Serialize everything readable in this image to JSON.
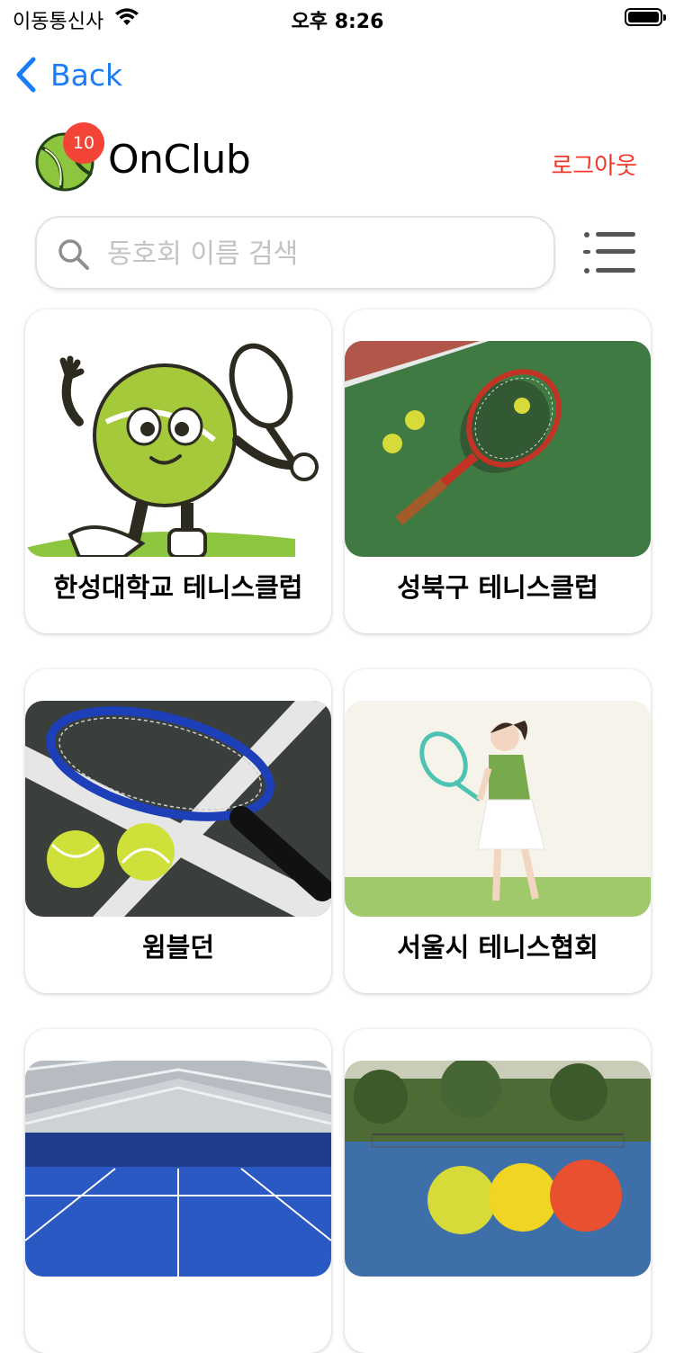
{
  "status_bar": {
    "carrier": "이동통신사",
    "time": "오후 8:26"
  },
  "nav": {
    "back_label": "Back"
  },
  "header": {
    "title": "OnClub",
    "badge_count": "10",
    "logout_label": "로그아웃"
  },
  "search": {
    "placeholder": "동호회 이름 검색",
    "value": ""
  },
  "colors": {
    "accent": "#1a7cf6",
    "logout": "#f0372a",
    "badge": "#f34437"
  },
  "clubs": [
    {
      "name": "한성대학교 테니스클럽",
      "image": "tennis-ball-mascot"
    },
    {
      "name": "성북구 테니스클럽",
      "image": "racket-on-court"
    },
    {
      "name": "윔블던",
      "image": "racket-and-balls"
    },
    {
      "name": "서울시 테니스협회",
      "image": "girl-player-illustration"
    },
    {
      "name": "",
      "image": "indoor-courts"
    },
    {
      "name": "",
      "image": "outdoor-court-balls"
    }
  ]
}
